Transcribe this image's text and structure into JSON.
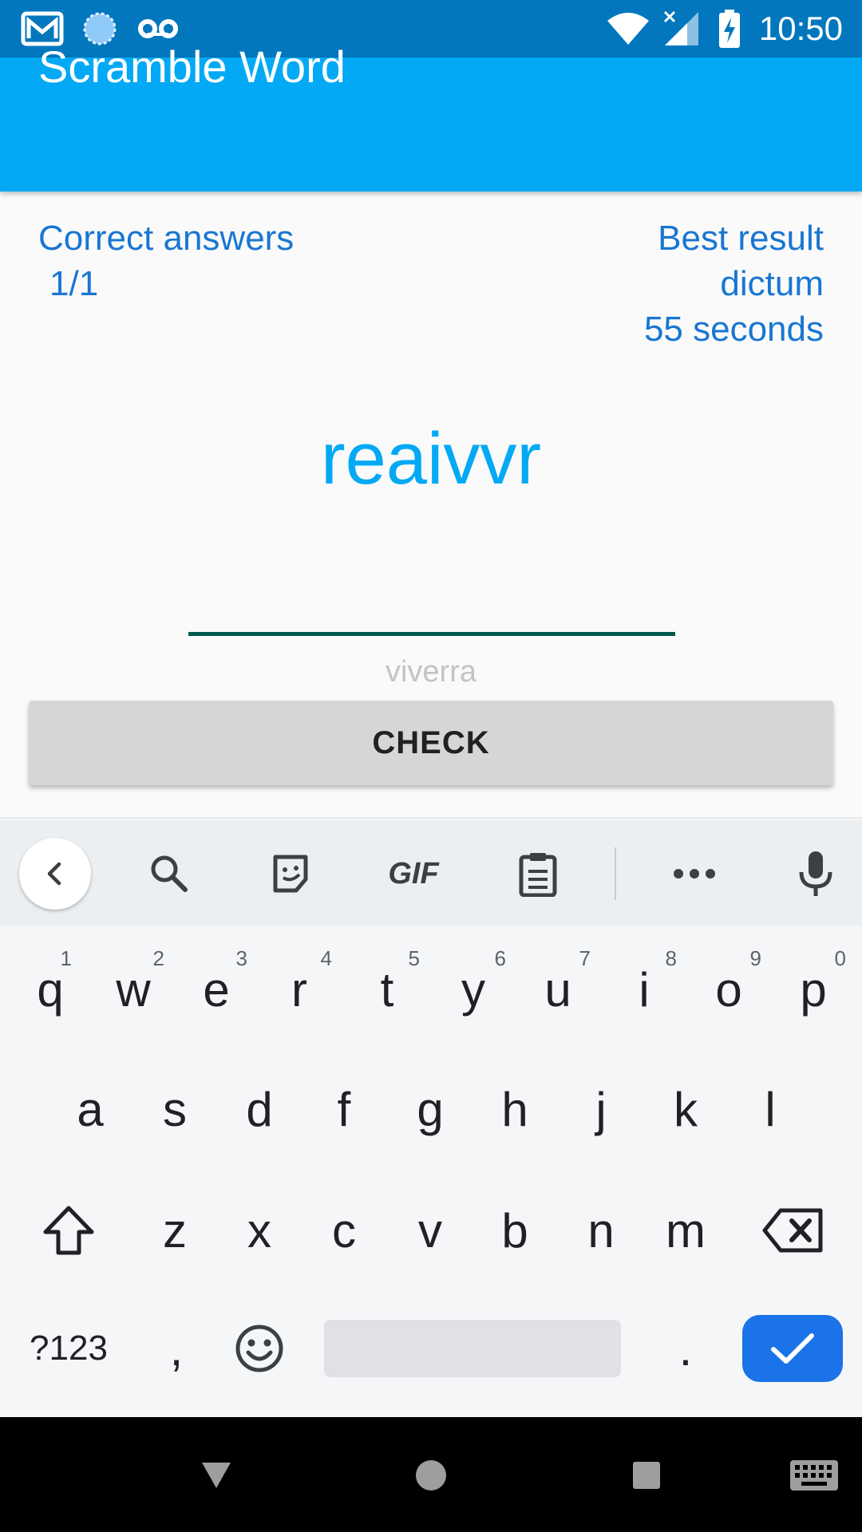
{
  "status_bar": {
    "time": "10:50",
    "icons": [
      "gmail-icon",
      "sync-icon",
      "voicemail-icon",
      "wifi-icon",
      "signal-icon",
      "battery-charging-icon"
    ]
  },
  "app_bar": {
    "title": "Scramble Word"
  },
  "stats": {
    "correct_label": "Correct answers",
    "correct_value": "1/1",
    "best_label": "Best result",
    "best_word": "dictum",
    "best_time": "55 seconds"
  },
  "puzzle": {
    "scrambled_word": "reaivvr",
    "answer_value": "",
    "hint": "viverra"
  },
  "actions": {
    "check_label": "CHECK"
  },
  "keyboard": {
    "toolbar": [
      "back-icon",
      "search-icon",
      "sticker-icon",
      "gif-icon",
      "clipboard-icon",
      "more-icon",
      "mic-icon"
    ],
    "gif_label": "GIF",
    "row1": [
      "q",
      "w",
      "e",
      "r",
      "t",
      "y",
      "u",
      "i",
      "o",
      "p"
    ],
    "row1_nums": [
      "1",
      "2",
      "3",
      "4",
      "5",
      "6",
      "7",
      "8",
      "9",
      "0"
    ],
    "row2": [
      "a",
      "s",
      "d",
      "f",
      "g",
      "h",
      "j",
      "k",
      "l"
    ],
    "row3": [
      "z",
      "x",
      "c",
      "v",
      "b",
      "n",
      "m"
    ],
    "symbols_label": "?123",
    "comma": ",",
    "period": "."
  },
  "colors": {
    "status_bar": "#0277bd",
    "app_bar": "#03a9f4",
    "stats_text": "#1976d2",
    "scrambled_text": "#03a9f4",
    "input_underline": "#00574b",
    "enter_key": "#1a73e8"
  }
}
